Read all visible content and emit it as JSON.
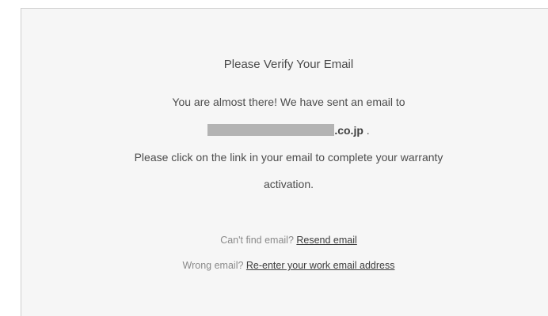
{
  "verify": {
    "title": "Please Verify Your Email",
    "sent_text": "You are almost there! We have sent an email to",
    "email_domain": ".co.jp",
    "email_suffix": " .",
    "instructions_line1": "Please click on the link in your email to complete your warranty",
    "instructions_line2": "activation."
  },
  "help": {
    "cant_find_text": "Can't find email? ",
    "resend_link": "Resend email",
    "wrong_email_text": "Wrong email? ",
    "reenter_link": "Re-enter your work email address"
  }
}
